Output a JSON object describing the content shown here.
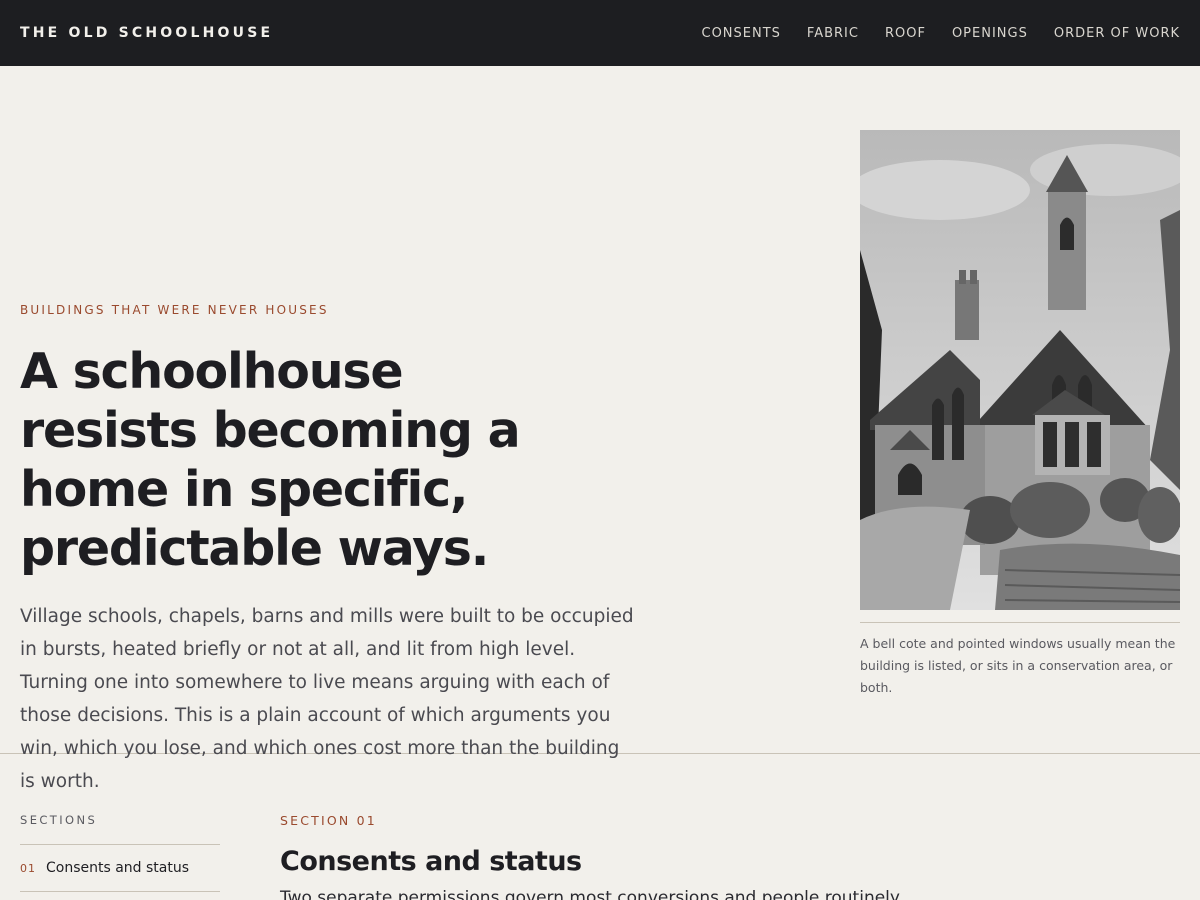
{
  "header": {
    "brand": "THE OLD SCHOOLHOUSE",
    "nav": [
      "CONSENTS",
      "FABRIC",
      "ROOF",
      "OPENINGS",
      "ORDER OF WORK"
    ]
  },
  "hero": {
    "eyebrow": "BUILDINGS THAT WERE NEVER HOUSES",
    "headline": "A schoolhouse resists becoming a home in specific, predictable ways.",
    "lede": "Village schools, chapels, barns and mills were built to be occupied in bursts, heated briefly or not at all, and lit from high level. Turning one into somewhere to live means arguing with each of those decisions. This is a plain account of which arguments you win, which you lose, and which ones cost more than the building is worth.",
    "image_alt": "Stone Victorian schoolhouse with bell cote and pointed windows",
    "caption": "A bell cote and pointed windows usually mean the building is listed, or sits in a conservation area, or both."
  },
  "sidebar": {
    "label": "SECTIONS",
    "items": [
      {
        "num": "01",
        "label": "Consents and status"
      }
    ]
  },
  "section": {
    "eyebrow": "SECTION 01",
    "title": "Consents and status",
    "body": "Two separate permissions govern most conversions and people routinely"
  },
  "colors": {
    "accent": "#9a4a2e",
    "header_bg": "#1d1e21",
    "page_bg": "#f2f0eb"
  }
}
